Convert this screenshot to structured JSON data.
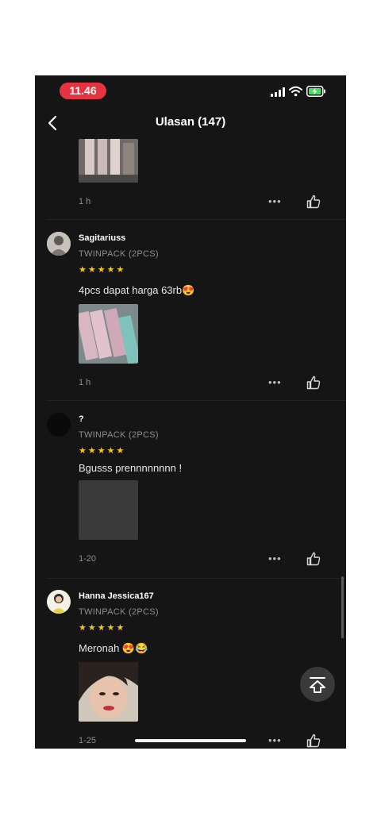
{
  "status_bar": {
    "time": "11.46"
  },
  "header": {
    "title": "Ulasan (147)"
  },
  "reviews": [
    {
      "time": "1 h"
    },
    {
      "username": "Sagitariuss",
      "variant": "TWINPACK (2PCS)",
      "stars": "★★★★★",
      "comment": "4pcs dapat harga 63rb😍",
      "time": "1 h"
    },
    {
      "username": "?",
      "variant": "TWINPACK (2PCS)",
      "stars": "★★★★★",
      "comment": "Bgusss prennnnnnnn !",
      "time": "1-20"
    },
    {
      "username": "Hanna Jessica167",
      "variant": "TWINPACK (2PCS)",
      "stars": "★★★★★",
      "comment": "Meronah 😍😂",
      "time": "1-25"
    }
  ],
  "more_label": "•••",
  "icons": {
    "back": "chevron-left-icon",
    "like": "thumbs-up-icon",
    "scroll_top": "arrow-up-icon"
  },
  "colors": {
    "background": "#151515",
    "time_pill": "#e5343f",
    "stars": "#f5c518"
  }
}
